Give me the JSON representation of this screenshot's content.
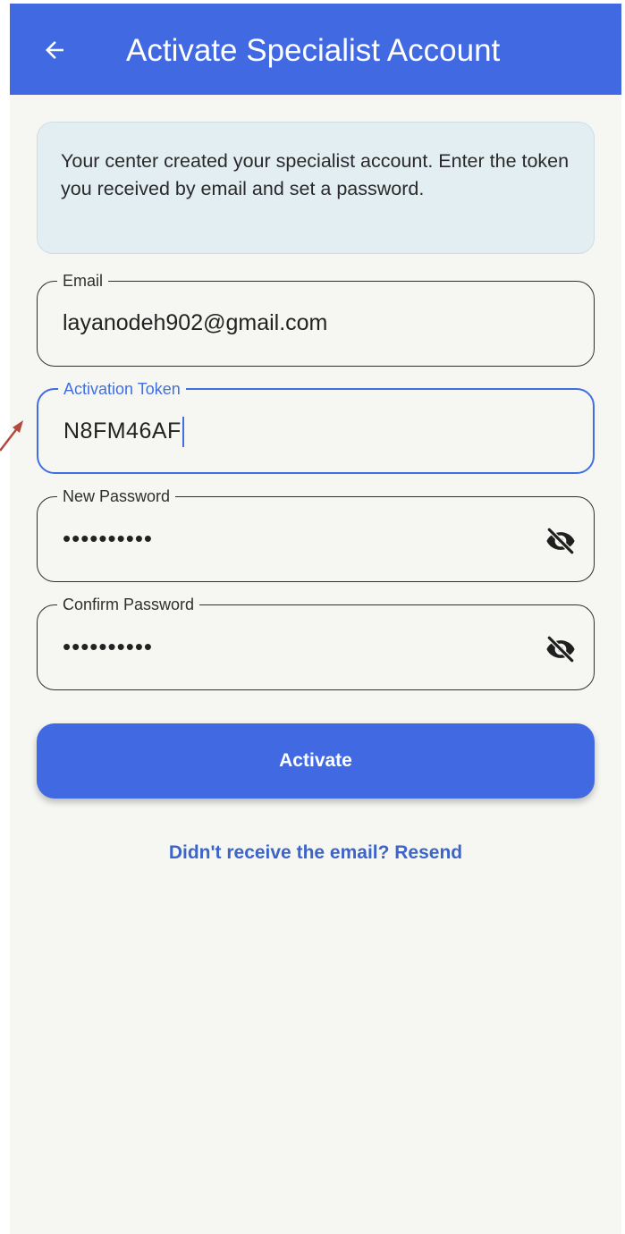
{
  "appbar": {
    "title": "Activate Specialist Account",
    "back_icon": "arrow-left-icon",
    "background": "#4169e1"
  },
  "info": {
    "text": "Your center created your specialist account. Enter the token you received by email and set a password."
  },
  "form": {
    "email": {
      "label": "Email",
      "value": "layanodeh902@gmail.com"
    },
    "token": {
      "label": "Activation Token",
      "value": "N8FM46AF",
      "focused": true
    },
    "new_password": {
      "label": "New Password",
      "value": "••••••••••",
      "visibility_icon": "eye-off-icon"
    },
    "confirm_password": {
      "label": "Confirm Password",
      "value": "••••••••••",
      "visibility_icon": "eye-off-icon"
    }
  },
  "actions": {
    "activate_label": "Activate",
    "resend_label": "Didn't receive the email? Resend"
  },
  "colors": {
    "primary": "#4169e1",
    "focus": "#3f6fe0",
    "link": "#3d64c9",
    "background": "#f6f7f2",
    "info_background": "#e3eef3",
    "annotation_arrow": "#b5473d"
  }
}
